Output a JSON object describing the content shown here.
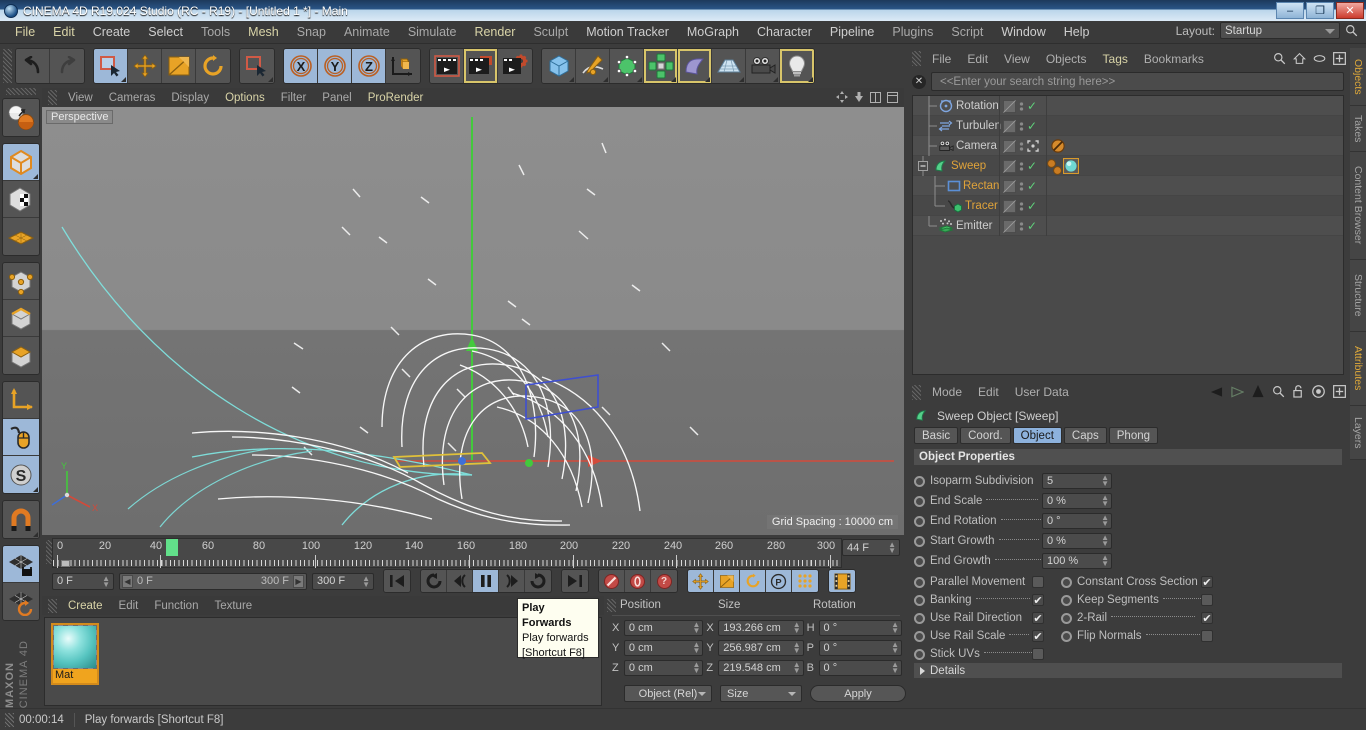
{
  "window": {
    "title": "CINEMA 4D R19.024 Studio (RC - R19) - [Untitled 1 *] - Main",
    "minimize": "–",
    "maximize": "❐",
    "close": "✕"
  },
  "menubar": {
    "items": [
      {
        "label": "File",
        "highlight": false
      },
      {
        "label": "Edit",
        "highlight": false
      },
      {
        "label": "Create",
        "highlight": true
      },
      {
        "label": "Select",
        "highlight": true
      },
      {
        "label": "Tools",
        "highlight": false
      },
      {
        "label": "Mesh",
        "highlight": true
      },
      {
        "label": "Snap",
        "highlight": false
      },
      {
        "label": "Animate",
        "highlight": false
      },
      {
        "label": "Simulate",
        "highlight": false
      },
      {
        "label": "Render",
        "highlight": true
      },
      {
        "label": "Sculpt",
        "highlight": false
      },
      {
        "label": "Motion Tracker",
        "highlight": true
      },
      {
        "label": "MoGraph",
        "highlight": true
      },
      {
        "label": "Character",
        "highlight": true
      },
      {
        "label": "Pipeline",
        "highlight": true
      },
      {
        "label": "Plugins",
        "highlight": false
      },
      {
        "label": "Script",
        "highlight": false
      },
      {
        "label": "Window",
        "highlight": true
      },
      {
        "label": "Help",
        "highlight": true
      }
    ],
    "layout_label": "Layout:",
    "layout_value": "Startup"
  },
  "viewport": {
    "menu": [
      {
        "label": "View",
        "highlight": false
      },
      {
        "label": "Cameras",
        "highlight": false
      },
      {
        "label": "Display",
        "highlight": false
      },
      {
        "label": "Options",
        "highlight": true
      },
      {
        "label": "Filter",
        "highlight": false
      },
      {
        "label": "Panel",
        "highlight": false
      },
      {
        "label": "ProRender",
        "highlight": true
      }
    ],
    "perspective_label": "Perspective",
    "grid_spacing": "Grid Spacing : 10000 cm",
    "axis_x": "X",
    "axis_y": "Y"
  },
  "timeline": {
    "ticks": [
      "0",
      "20",
      "40",
      "60",
      "80",
      "100",
      "120",
      "140",
      "160",
      "180",
      "200",
      "220",
      "240",
      "260",
      "280",
      "300"
    ],
    "current_frame_field": "44 F",
    "start_frame": "0 F",
    "range_start": "0 F",
    "range_end": "300 F",
    "end_frame": "300 F",
    "playhead_frame": 44
  },
  "tooltip": {
    "title": "Play Forwards",
    "description": "Play forwards",
    "shortcut": "[Shortcut F8]"
  },
  "material_manager": {
    "menu": [
      {
        "label": "Create",
        "highlight": true
      },
      {
        "label": "Edit",
        "highlight": false
      },
      {
        "label": "Function",
        "highlight": false
      },
      {
        "label": "Texture",
        "highlight": false
      }
    ],
    "materials": [
      {
        "name": "Mat"
      }
    ]
  },
  "coordinates": {
    "headers": [
      "Position",
      "Size",
      "Rotation"
    ],
    "rows": [
      {
        "pos_axis": "X",
        "pos_val": "0 cm",
        "size_axis": "X",
        "size_val": "193.266 cm",
        "rot_axis": "H",
        "rot_val": "0 °"
      },
      {
        "pos_axis": "Y",
        "pos_val": "0 cm",
        "size_axis": "Y",
        "size_val": "256.987 cm",
        "rot_axis": "P",
        "rot_val": "0 °"
      },
      {
        "pos_axis": "Z",
        "pos_val": "0 cm",
        "size_axis": "Z",
        "size_val": "219.548 cm",
        "rot_axis": "B",
        "rot_val": "0 °"
      }
    ],
    "mode_dropdown": "Object (Rel)",
    "size_dropdown": "Size",
    "apply_button": "Apply"
  },
  "object_manager": {
    "menu": [
      {
        "label": "File",
        "highlight": false
      },
      {
        "label": "Edit",
        "highlight": false
      },
      {
        "label": "View",
        "highlight": false
      },
      {
        "label": "Objects",
        "highlight": false
      },
      {
        "label": "Tags",
        "highlight": true
      },
      {
        "label": "Bookmarks",
        "highlight": false
      }
    ],
    "search_placeholder": "<<Enter your search string here>>",
    "objects": [
      {
        "name": "Rotation",
        "indent": 1,
        "color": "normal",
        "icon": "rotation-icon",
        "visible_check": true
      },
      {
        "name": "Turbulen",
        "indent": 1,
        "color": "normal",
        "icon": "turbulence-icon",
        "visible_check": true
      },
      {
        "name": "Camera",
        "indent": 1,
        "color": "normal",
        "icon": "camera-icon",
        "visible_check": false
      },
      {
        "name": "Sweep",
        "indent": 1,
        "color": "orange",
        "icon": "sweep-icon",
        "visible_check": true
      },
      {
        "name": "Rectan",
        "indent": 2,
        "color": "orange",
        "icon": "rectangle-spline-icon",
        "visible_check": true
      },
      {
        "name": "Tracer",
        "indent": 2,
        "color": "orange",
        "icon": "tracer-icon",
        "visible_check": true
      },
      {
        "name": "Emitter",
        "indent": 1,
        "color": "normal",
        "icon": "emitter-icon",
        "visible_check": true
      }
    ]
  },
  "attribute_manager": {
    "menu": [
      {
        "label": "Mode",
        "highlight": false
      },
      {
        "label": "Edit",
        "highlight": false
      },
      {
        "label": "User Data",
        "highlight": false
      }
    ],
    "object_title": "Sweep Object [Sweep]",
    "tabs": [
      {
        "label": "Basic",
        "active": false
      },
      {
        "label": "Coord.",
        "active": false
      },
      {
        "label": "Object",
        "active": true
      },
      {
        "label": "Caps",
        "active": false
      },
      {
        "label": "Phong",
        "active": false
      }
    ],
    "section_title": "Object Properties",
    "fields": [
      {
        "label": "Isoparm Subdivision",
        "value": "5",
        "dots": false
      },
      {
        "label": "End Scale",
        "value": "0 %",
        "dots": true
      },
      {
        "label": "End Rotation",
        "value": "0 °",
        "dots": true
      },
      {
        "label": "Start Growth",
        "value": "0 %",
        "dots": true
      },
      {
        "label": "End Growth",
        "value": "100 %",
        "dots": true
      }
    ],
    "checkboxes_left": [
      {
        "label": "Parallel Movement",
        "checked": false,
        "dots": false
      },
      {
        "label": "Banking",
        "checked": true,
        "dots": true
      },
      {
        "label": "Use Rail Direction",
        "checked": true,
        "dots": false
      },
      {
        "label": "Use Rail Scale",
        "checked": true,
        "dots": true
      },
      {
        "label": "Stick UVs",
        "checked": false,
        "dots": true
      }
    ],
    "checkboxes_right": [
      {
        "label": "Constant Cross Section",
        "checked": true,
        "dots": false
      },
      {
        "label": "Keep Segments",
        "checked": false,
        "dots": true
      },
      {
        "label": "2-Rail",
        "checked": true,
        "dots": true
      },
      {
        "label": "Flip Normals",
        "checked": false,
        "dots": true
      }
    ],
    "details_label": "Details"
  },
  "right_tabs": [
    {
      "label": "Objects",
      "active": true
    },
    {
      "label": "Takes",
      "active": false
    },
    {
      "label": "Content Browser",
      "active": false
    },
    {
      "label": "Structure",
      "active": false
    },
    {
      "label": "Attributes",
      "active": true
    },
    {
      "label": "Layers",
      "active": false
    }
  ],
  "statusbar": {
    "time": "00:00:14",
    "message": "Play forwards [Shortcut F8]"
  },
  "branding": {
    "line1": "MAXON",
    "line2": "CINEMA 4D"
  },
  "colors": {
    "accent_orange": "#e0a33a",
    "selection_blue": "#9db8d8",
    "highlight_yellow": "#d9d4a8",
    "green_check": "#5fcf7a",
    "playhead_green": "#62e08a"
  }
}
